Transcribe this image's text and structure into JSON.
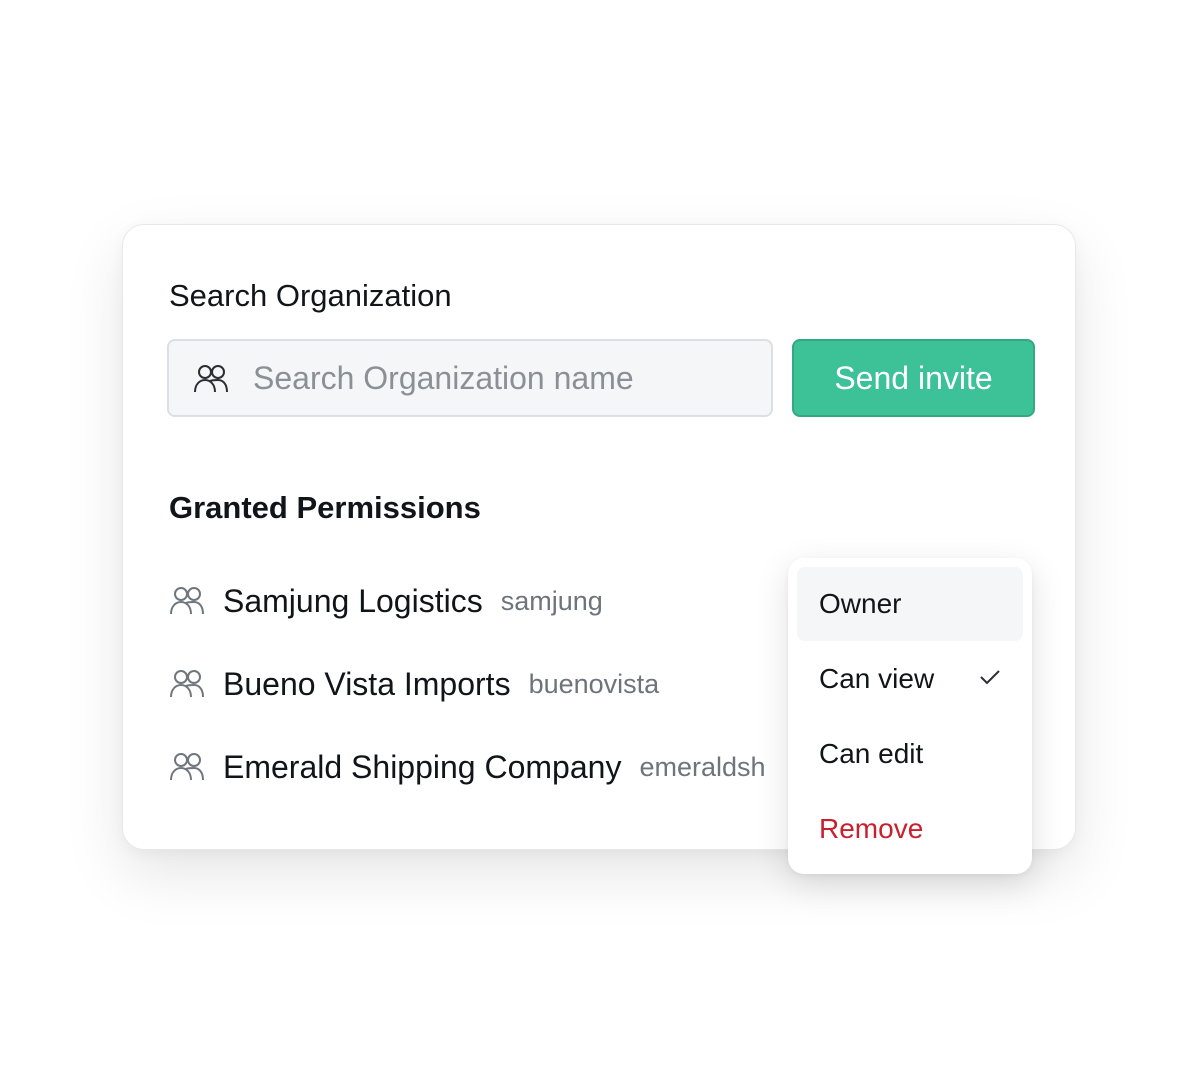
{
  "search": {
    "title": "Search Organization",
    "placeholder": "Search Organization name",
    "value": "",
    "icon": "users-icon",
    "button_label": "Send invite"
  },
  "permissions": {
    "title": "Granted Permissions",
    "items": [
      {
        "name": "Samjung Logistics",
        "handle": "samjung",
        "icon": "users-icon"
      },
      {
        "name": "Bueno Vista Imports",
        "handle": "buenovista",
        "icon": "users-icon"
      },
      {
        "name": "Emerald Shipping Company",
        "handle": "emeraldsh",
        "icon": "users-icon"
      }
    ]
  },
  "role_menu": {
    "options": [
      {
        "label": "Owner",
        "highlighted": true
      },
      {
        "label": "Can view",
        "selected": true
      },
      {
        "label": "Can edit"
      },
      {
        "label": "Remove",
        "danger": true
      }
    ],
    "selected_icon": "checkmark-icon"
  },
  "colors": {
    "accent": "#3dc196",
    "danger": "#c8202f",
    "text": "#111418",
    "muted": "#6e747b"
  }
}
